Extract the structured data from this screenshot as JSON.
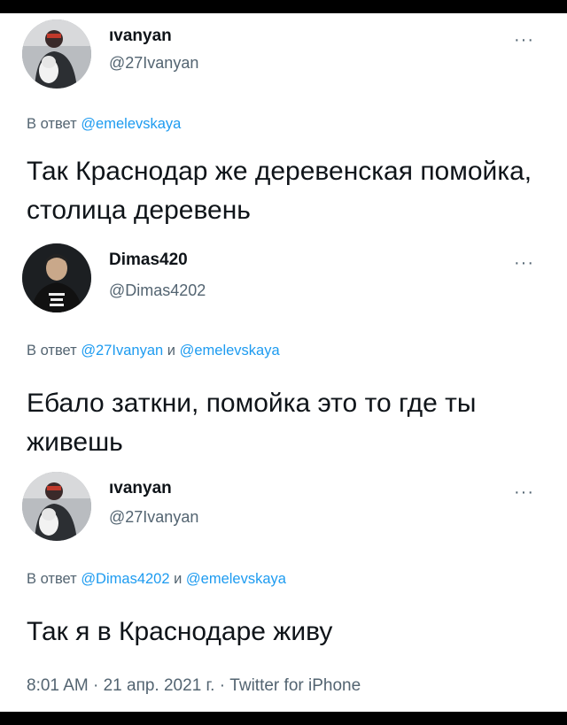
{
  "tweets": [
    {
      "name": "ıvanyan",
      "handle": "@27Ivanyan",
      "reply_prefix": "В ответ ",
      "mentions": [
        "@emelevskaya"
      ],
      "text": "Так Краснодар же деревенская помойка, столица деревень"
    },
    {
      "name": "Dimas420",
      "handle": "@Dimas4202",
      "reply_prefix": "В ответ ",
      "mentions": [
        "@27Ivanyan",
        "@emelevskaya"
      ],
      "joiner": " и ",
      "text": "Ебало заткни, помойка это то где ты живешь"
    },
    {
      "name": "ıvanyan",
      "handle": "@27Ivanyan",
      "reply_prefix": "В ответ ",
      "mentions": [
        "@Dimas4202",
        "@emelevskaya"
      ],
      "joiner": " и ",
      "text": "Так я в Краснодаре живу",
      "meta": "8:01 AM · 21 апр. 2021 г. · Twitter for iPhone"
    }
  ],
  "more_label": "···",
  "colors": {
    "mention": "#1d9bf0",
    "secondary": "#536471",
    "text": "#0f1419"
  }
}
